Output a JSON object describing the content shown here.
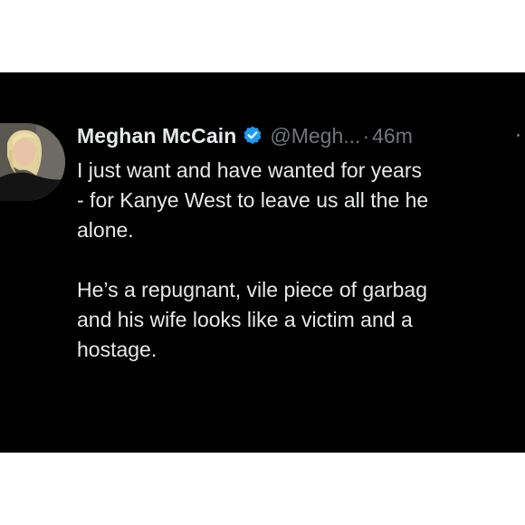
{
  "tweet": {
    "display_name": "Meghan McCain",
    "handle": "@Megh...",
    "separator": "·",
    "timestamp": "46m",
    "lines": [
      "I just want and have wanted for years",
      "- for Kanye West to leave us all the he",
      "alone.",
      "He’s a repugnant, vile piece of garbag",
      "and his wife looks like a victim and a",
      "hostage."
    ]
  },
  "icons": {
    "verified": "verified-badge-icon",
    "more": "more-options-icon"
  },
  "colors": {
    "background": "#000000",
    "text": "#e7e9ea",
    "secondary": "#71767b",
    "verified": "#1d9bf0"
  }
}
